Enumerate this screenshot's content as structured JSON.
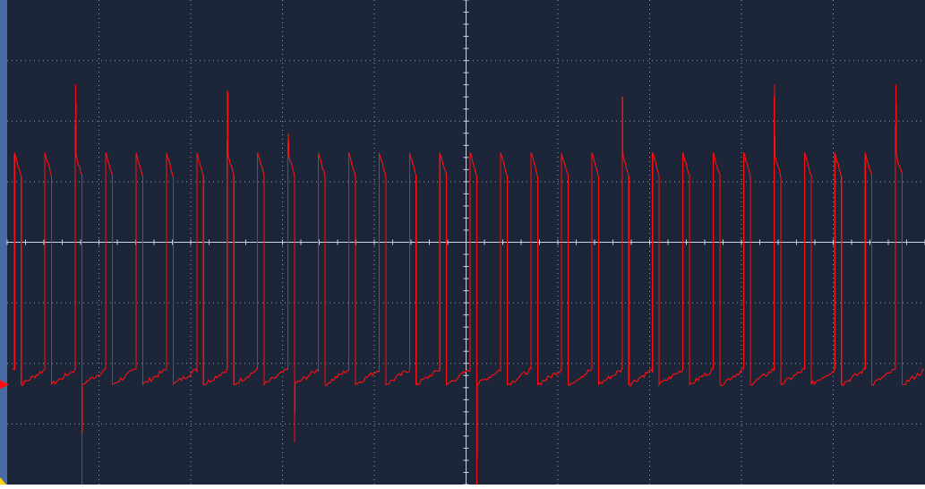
{
  "chart_data": {
    "type": "line",
    "title": "",
    "xlabel": "",
    "ylabel": "",
    "x_divisions": 10,
    "y_divisions": 8,
    "xlim": [
      0,
      10
    ],
    "ylim": [
      -4,
      4
    ],
    "grid": true,
    "legend": "none",
    "series": [
      {
        "color": "#ff1010",
        "waveform": "pulse-train",
        "pulse_count": 30,
        "period_div": 0.331,
        "first_edge_div": 0.08,
        "high_level_div": 1.48,
        "high_end_level_div": 1.1,
        "low_level_div": -2.35,
        "low_end_level_div": -2.1,
        "high_fraction": 0.22,
        "spikes": [
          {
            "pulse": 2,
            "peak_div": 2.6,
            "dip_div": -4.0
          },
          {
            "pulse": 7,
            "peak_div": 2.5,
            "dip_div": null
          },
          {
            "pulse": 9,
            "peak_div": 1.8,
            "dip_div": -3.3
          },
          {
            "pulse": 15,
            "peak_div": null,
            "dip_div": -4.0
          },
          {
            "pulse": 20,
            "peak_div": 2.4,
            "dip_div": null
          },
          {
            "pulse": 25,
            "peak_div": 2.6,
            "dip_div": null
          },
          {
            "pulse": 29,
            "peak_div": 2.6,
            "dip_div": null
          }
        ]
      }
    ]
  },
  "colors": {
    "background": "#1d2638",
    "grid": "#b8c4d8",
    "trace": "#ff1010",
    "left_bezel": "#4a6aa6",
    "ground_marker": "#ff1010",
    "trigger_marker": "#ffd400"
  },
  "icons": {
    "ground_marker": "channel-ground-arrow-icon",
    "trigger_marker": "trigger-point-icon"
  }
}
